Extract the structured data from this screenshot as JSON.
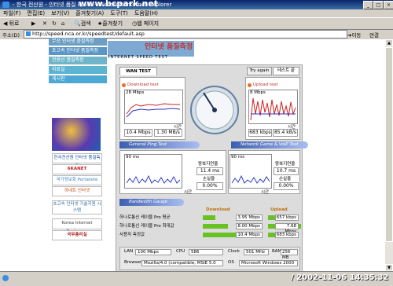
{
  "window": {
    "title": "- 한국 전산원 - 인터넷 품질 테스트 - Microsoft Internet Explorer",
    "watermark": "www.bcpark.net"
  },
  "menubar": {
    "items": [
      "파일(F)",
      "편집(E)",
      "보기(V)",
      "즐겨찾기(A)",
      "도구(T)",
      "도움말(H)"
    ]
  },
  "toolbar": {
    "back": "뒤로",
    "search": "검색",
    "favorites": "즐겨찾기",
    "history": "웹 페이지"
  },
  "addressbar": {
    "label": "주소(D)",
    "url": "http://speed.nca.or.kr/speedtest/default.asp",
    "go": "이동",
    "links": "연결"
  },
  "sidenav": {
    "items": [
      "무선 인터넷 품질측정",
      "초고속 인터넷 품질측정",
      "전용선 품질측정",
      "자료실",
      "게시판"
    ]
  },
  "header": {
    "title": "인터넷 품질측정",
    "subtitle": "INTERNET SPEED TEST"
  },
  "tabs": {
    "wan": "WAN TEST",
    "try_again": "Try again",
    "test_end": "테스트 끝"
  },
  "download": {
    "title": "Download test",
    "scale": "28 Mbps",
    "axis": "시간",
    "speed1": "10.4 Mbps",
    "speed2": "1.30 MB/s"
  },
  "upload": {
    "title": "Upload test",
    "scale": "8 Mbps",
    "axis": "시간",
    "speed1": "683 kbps",
    "speed2": "85.4 kB/s"
  },
  "ping": {
    "title": "General Ping Test",
    "scale": "90 ms",
    "axis": "시간",
    "delay_label": "왕복지연율",
    "delay_value": "11.4 ms",
    "loss_label": "손실율",
    "loss_value": "0.00%"
  },
  "voip": {
    "title": "Network Game & VoIP Test",
    "scale": "90 ms",
    "axis": "시간",
    "delay_label": "왕복지연율",
    "delay_value": "10.7 ms",
    "loss_label": "손실율",
    "loss_value": "0.00%"
  },
  "bandwidth": {
    "title": "Bandwidth Gauge",
    "download_label": "Download",
    "upload_label": "Upload",
    "rows": [
      {
        "label": "하나로통신 케이블 Pro 평균",
        "download": "3.95 Mbps",
        "download_pct": 0.38,
        "upload": "657 kbps",
        "upload_pct": 0.86
      },
      {
        "label": "하나로통신 케이블 Pro 최대값",
        "download": "8.00 Mbps",
        "download_pct": 0.77,
        "upload": "7.68 Mbps",
        "upload_pct": 1.0
      },
      {
        "label": "사용자 측정값",
        "download": "10.4 Mbps",
        "download_pct": 1.0,
        "upload": "683 kbps",
        "upload_pct": 0.89
      }
    ]
  },
  "specs": {
    "lan_label": "LAN",
    "lan": "100 Mbps",
    "cpu_label": "CPU",
    "cpu": "586",
    "clock_label": "Clock",
    "clock": "501 MHz",
    "ram_label": "RAM",
    "ram": "256 MB",
    "browser_label": "Browser",
    "browser": "Mozilla/4.0 (compatible; MSIE 5.0",
    "os_label": "OS",
    "os": "Microsoft Windows 2000"
  },
  "logos": [
    "한국전산원 인터넷 품질측정",
    "6KANET",
    "국가정보화 Portalsite",
    "하네트 인터넷",
    "초고속 인터넷 기술지원 시스템",
    "Korea Internet Exchange",
    "국무총리실"
  ],
  "statusbar": {
    "timestamp": "/ 2002-11-06 14:35:32"
  }
}
